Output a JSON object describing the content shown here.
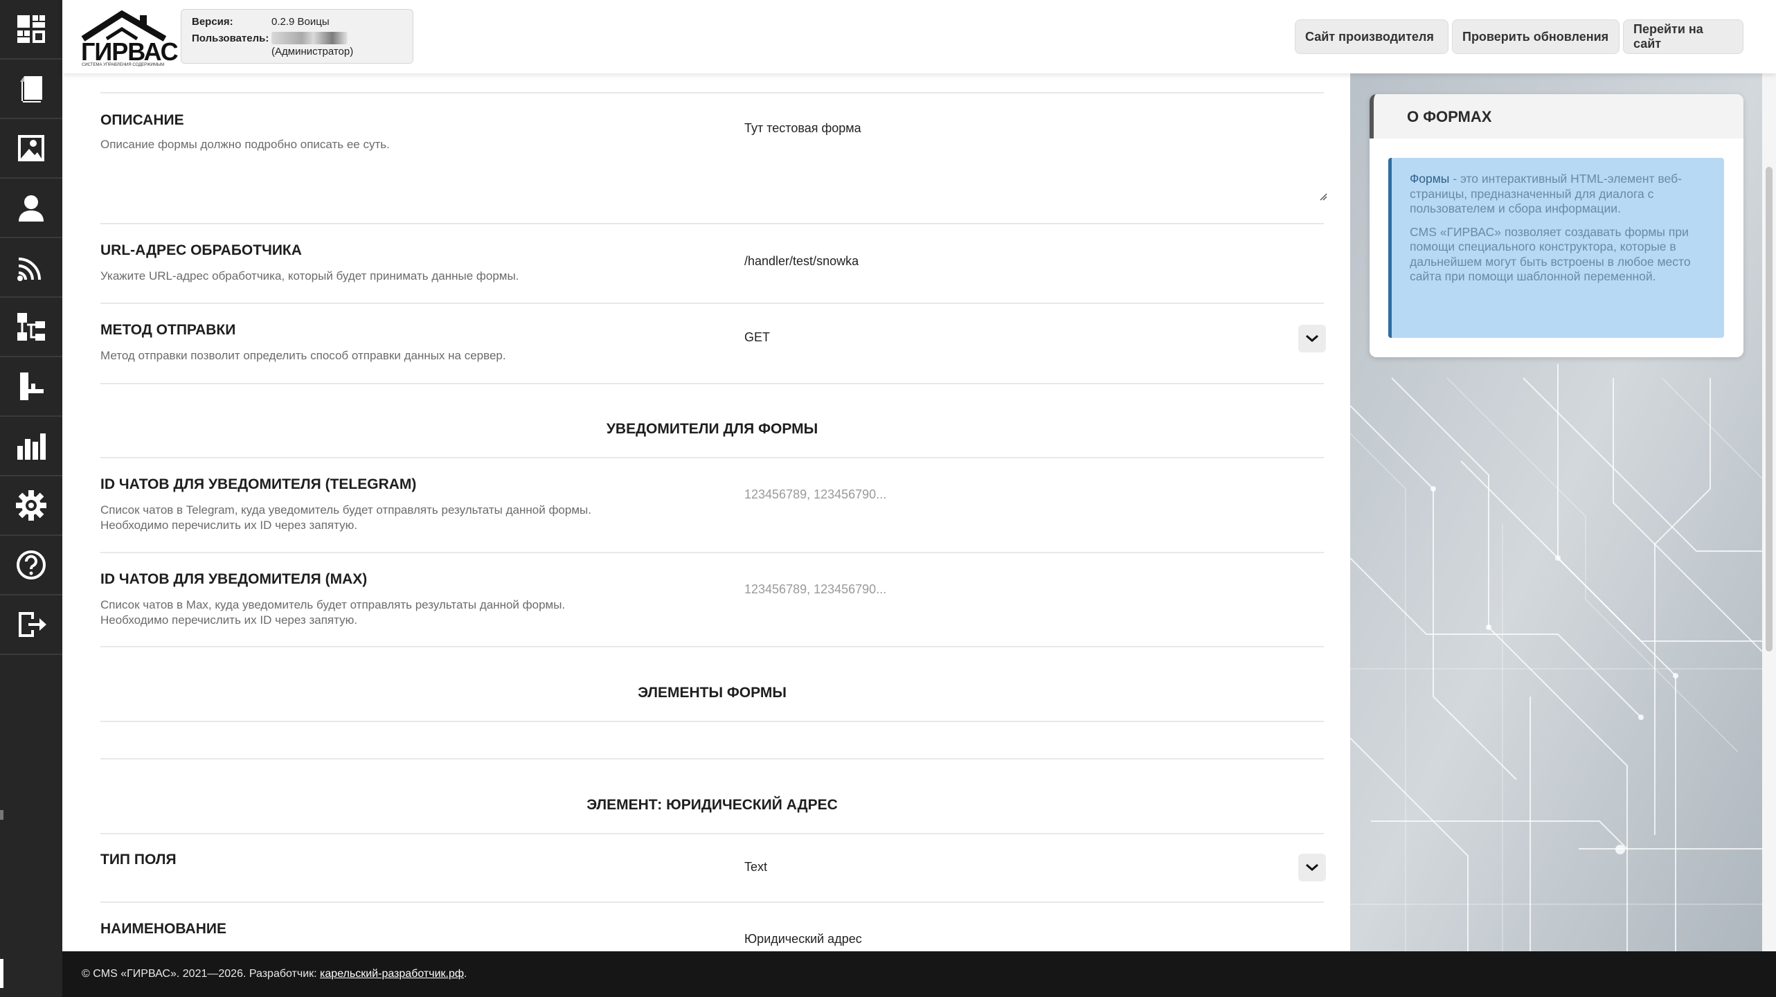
{
  "sidebar": {
    "items": [
      {
        "icon": "dashboard-icon"
      },
      {
        "icon": "pages-icon"
      },
      {
        "icon": "image-icon"
      },
      {
        "icon": "user-icon"
      },
      {
        "icon": "rss-icon"
      },
      {
        "icon": "sitemap-icon"
      },
      {
        "icon": "paint-roller-icon"
      },
      {
        "icon": "bar-chart-icon"
      },
      {
        "icon": "gear-icon"
      },
      {
        "icon": "help-icon"
      },
      {
        "icon": "logout-icon"
      }
    ]
  },
  "header": {
    "logo_text": "ГИРВАС",
    "logo_subtitle": "СИСТЕМА УПРАВЛЕНИЯ СОДЕРЖИМЫМ",
    "version_label": "Версия:",
    "version_value": "0.2.9 Воицы",
    "user_label": "Пользователь:",
    "user_role": "(Администратор)",
    "buttons": {
      "vendor_site": "Сайт производителя",
      "check_updates": "Проверить обновления",
      "go_to_site": "Перейти на сайт"
    }
  },
  "form": {
    "description": {
      "label": "ОПИСАНИЕ",
      "hint": "Описание формы должно подробно описать ее суть.",
      "value": "Тут тестовая форма"
    },
    "handler_url": {
      "label": "URL-АДРЕС ОБРАБОТЧИКА",
      "hint": "Укажите URL-адрес обработчика, который будет принимать данные формы.",
      "value": "/handler/test/snowka"
    },
    "method": {
      "label": "МЕТОД ОТПРАВКИ",
      "hint": "Метод отправки позволит определить способ отправки данных на сервер.",
      "value": "GET"
    },
    "notifiers_title": "УВЕДОМИТЕЛИ ДЛЯ ФОРМЫ",
    "telegram": {
      "label": "ID ЧАТОВ ДЛЯ УВЕДОМИТЕЛЯ (TELEGRAM)",
      "hint_line1": "Список чатов в Telegram, куда уведомитель будет отправлять результаты данной формы.",
      "hint_line2": "Необходимо перечислить их ID через запятую.",
      "placeholder": "123456789, 123456790..."
    },
    "max": {
      "label": "ID ЧАТОВ ДЛЯ УВЕДОМИТЕЛЯ (MAX)",
      "hint_line1": "Список чатов в Max, куда уведомитель будет отправлять результаты данной формы.",
      "hint_line2": "Необходимо перечислить их ID через запятую.",
      "placeholder": "123456789, 123456790..."
    },
    "elements_title": "ЭЛЕМЕНТЫ ФОРМЫ",
    "element_title": "ЭЛЕМЕНТ: ЮРИДИЧЕСКИЙ АДРЕС",
    "field_type": {
      "label": "ТИП ПОЛЯ",
      "value": "Text"
    },
    "name": {
      "label": "НАИМЕНОВАНИЕ",
      "value": "Юридический адрес"
    }
  },
  "info_panel": {
    "title": "О ФОРМАХ",
    "p1_keyword": "Формы",
    "p1_rest": " - это интерактивный HTML-элемент веб-страницы, предназначенный для диалога с пользователем и сбора информации.",
    "p2": "CMS «ГИРВАС» позволяет создавать формы при помощи специального конструктора, которые в дальнейшем могут быть встроены в любое место сайта при помощи шаблонной переменной."
  },
  "footer": {
    "text": "© CMS «ГИРВАС». 2021—2026. Разработчик: ",
    "link": "карельский-разработчик.рф",
    "suffix": "."
  },
  "colors": {
    "sidebar_bg": "#262626",
    "footer_bg": "#161616",
    "info_box_bg": "#b7d9f4",
    "info_box_border": "#2e6da4"
  }
}
